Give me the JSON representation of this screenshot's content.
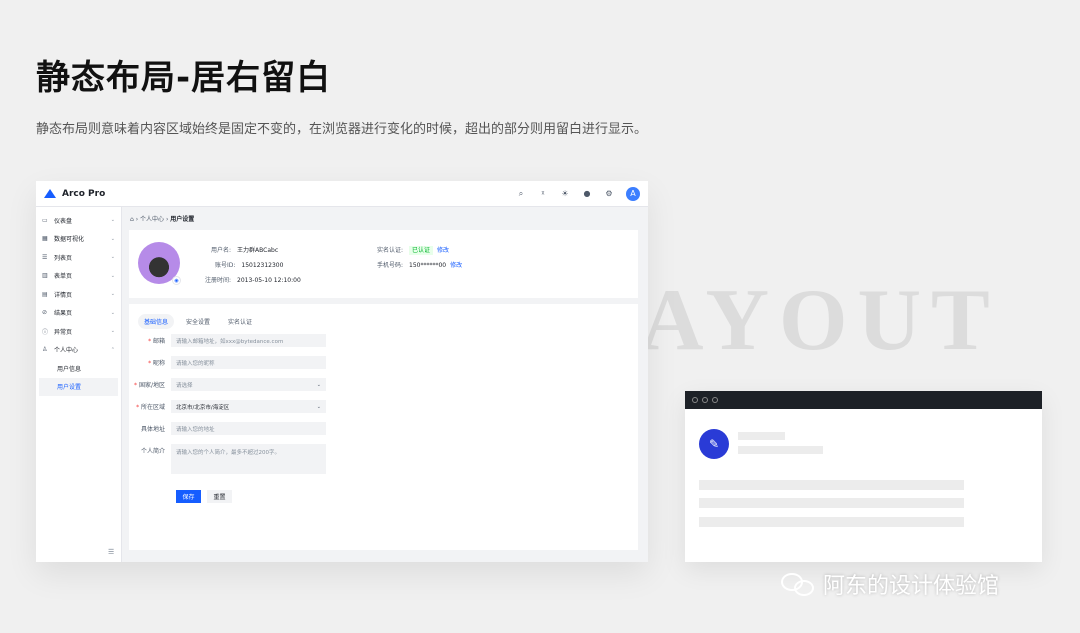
{
  "page": {
    "title": "静态布局-居右留白",
    "subtitle": "静态布局则意味着内容区域始终是固定不变的，在浏览器进行变化的时候，超出的部分则用留白进行显示。",
    "watermark": "AYOUT",
    "footer_brand": "阿东的设计体验馆"
  },
  "app": {
    "name": "Arco Pro",
    "avatar_letter": "A",
    "topbar_icons": [
      "search-icon",
      "translate-icon",
      "theme-icon",
      "bell-icon",
      "settings-icon"
    ],
    "sidebar": {
      "items": [
        {
          "label": "仪表盘",
          "icon": "dashboard-icon"
        },
        {
          "label": "数据可视化",
          "icon": "chart-icon"
        },
        {
          "label": "列表页",
          "icon": "list-icon"
        },
        {
          "label": "表单页",
          "icon": "form-icon"
        },
        {
          "label": "详情页",
          "icon": "detail-icon"
        },
        {
          "label": "结果页",
          "icon": "result-icon"
        },
        {
          "label": "异常页",
          "icon": "exception-icon"
        },
        {
          "label": "个人中心",
          "icon": "user-icon"
        }
      ],
      "sub_items": [
        {
          "label": "用户信息",
          "active": false
        },
        {
          "label": "用户设置",
          "active": true
        }
      ]
    },
    "breadcrumb": {
      "parent": "个人中心",
      "current": "用户设置"
    },
    "profile": {
      "username_label": "用户名:",
      "username": "王力群ABCabc",
      "account_label": "账号ID:",
      "account": "15012312300",
      "register_label": "注册时间:",
      "register_time": "2013-05-10 12:10:00",
      "realname_label": "实名认证:",
      "realname_status": "已认证",
      "phone_label": "手机号码:",
      "phone": "150******00",
      "edit_label": "修改"
    },
    "tabs": [
      {
        "label": "基础信息",
        "active": true
      },
      {
        "label": "安全设置",
        "active": false
      },
      {
        "label": "实名认证",
        "active": false
      }
    ],
    "form": {
      "email": {
        "label": "邮箱",
        "placeholder": "请输入邮箱地址，如xxx@bytedance.com",
        "required": true
      },
      "nickname": {
        "label": "昵称",
        "placeholder": "请输入您的昵称",
        "required": true
      },
      "country": {
        "label": "国家/地区",
        "placeholder": "请选择",
        "required": true
      },
      "region": {
        "label": "所在区域",
        "value": "北京市/北京市/海淀区",
        "required": true
      },
      "address": {
        "label": "具体地址",
        "placeholder": "请输入您的地址",
        "required": false
      },
      "bio": {
        "label": "个人简介",
        "placeholder": "请输入您的个人简介，最多不超过200字。",
        "required": false
      },
      "save_label": "保存",
      "reset_label": "重置"
    }
  }
}
